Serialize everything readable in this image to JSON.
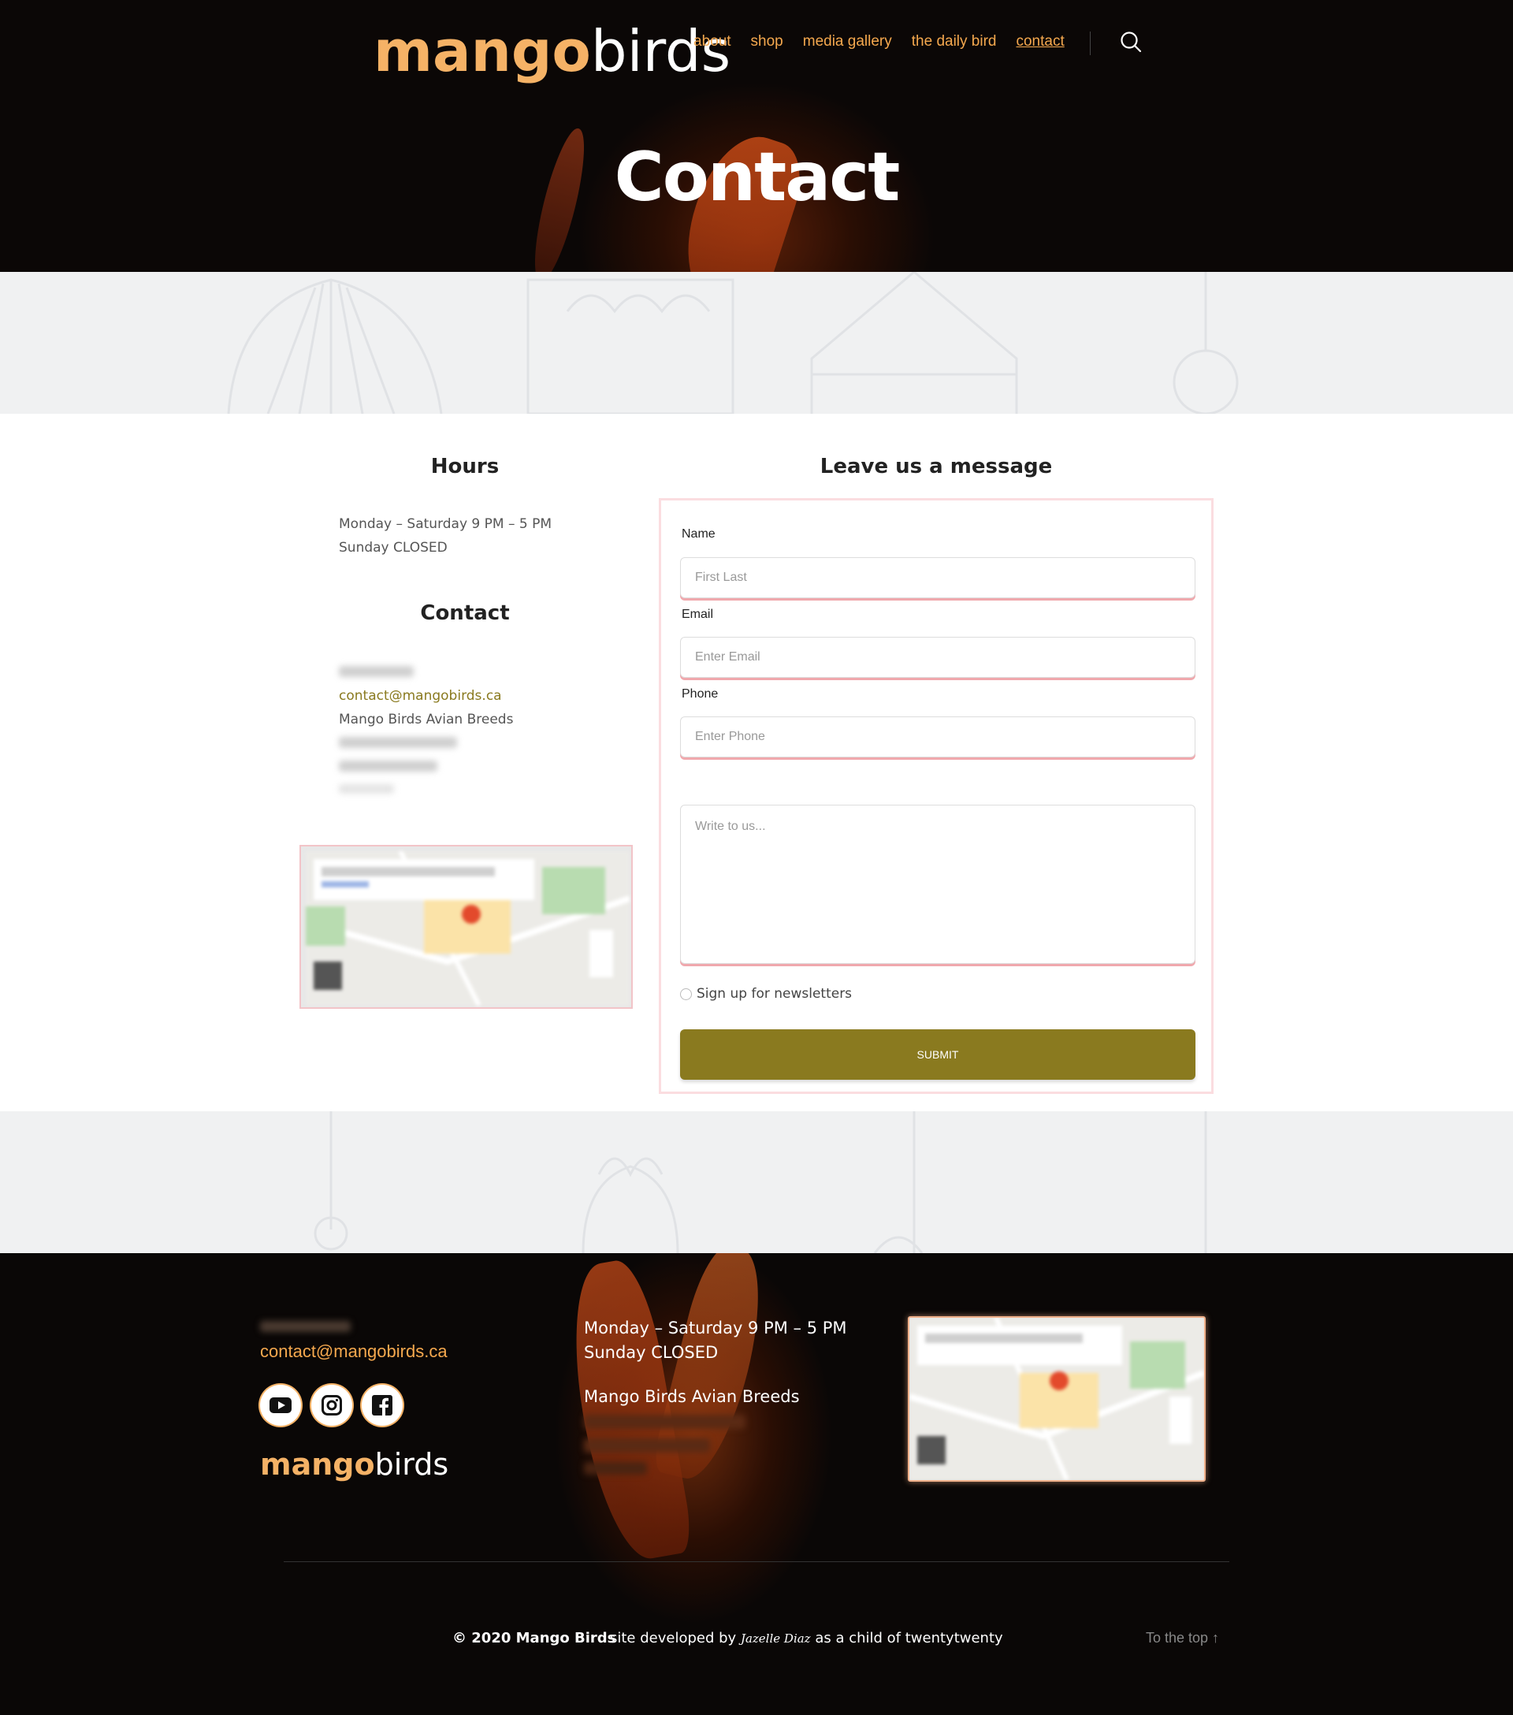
{
  "header": {
    "logo_mango": "mango",
    "logo_birds": "birds",
    "nav": [
      {
        "label": "about"
      },
      {
        "label": "shop"
      },
      {
        "label": "media gallery"
      },
      {
        "label": "the daily bird"
      },
      {
        "label": "contact",
        "active": true
      }
    ],
    "search_icon": "search-icon",
    "page_title": "Contact"
  },
  "main": {
    "hours_heading": "Hours",
    "hours_line1": "Monday – Saturday 9 PM – 5 PM",
    "hours_line2": "Sunday CLOSED",
    "contact_heading": "Contact",
    "contact_email": "contact@mangobirds.ca",
    "contact_business": "Mango Birds Avian Breeds",
    "message_heading": "Leave us a message",
    "form": {
      "name_label": "Name",
      "name_placeholder": "First Last",
      "email_label": "Email",
      "email_placeholder": "Enter Email",
      "phone_label": "Phone",
      "phone_placeholder": "Enter Phone",
      "message_placeholder": "Write to us...",
      "newsletter_label": "Sign up for newsletters",
      "submit_label": "SUBMIT"
    }
  },
  "footer": {
    "email": "contact@mangobirds.ca",
    "hours_line1": "Monday – Saturday 9 PM – 5 PM",
    "hours_line2": "Sunday CLOSED",
    "business": "Mango Birds Avian Breeds",
    "social": [
      "youtube-icon",
      "instagram-icon",
      "facebook-icon"
    ],
    "logo_mango": "mango",
    "logo_birds": "birds",
    "copyright": "© 2020 Mango Birds",
    "developed_prefix": "site developed by",
    "developer": "Jazelle Diaz",
    "developed_suffix": "as a child of twentytwenty",
    "to_top": "To the top ↑"
  },
  "colors": {
    "accent": "#f5a84e",
    "submit": "#8a7a1f",
    "form_border": "#fbdde0"
  }
}
